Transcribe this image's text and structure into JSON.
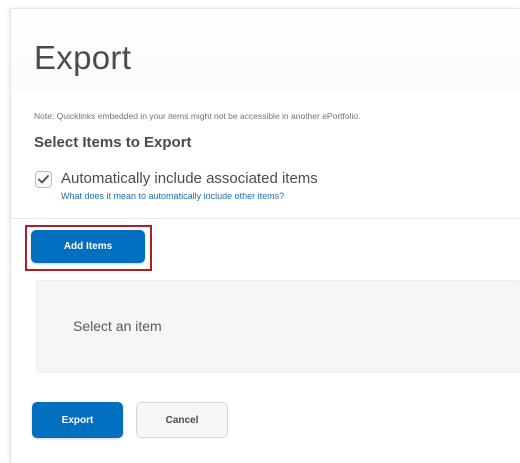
{
  "header": {
    "title": "Export"
  },
  "note": "Note: Quicklinks embedded in your items might not be accessible in another ePortfolio.",
  "section": {
    "title": "Select Items to Export"
  },
  "auto_include": {
    "checked": true,
    "label": "Automatically include associated items",
    "help_link": "What does it mean to automatically include other items?"
  },
  "add_items": {
    "label": "Add Items",
    "highlight_color": "#b11d24"
  },
  "selection": {
    "placeholder": "Select an item"
  },
  "actions": {
    "export_label": "Export",
    "cancel_label": "Cancel"
  },
  "colors": {
    "primary": "#006fbf",
    "link": "#1c6fb0",
    "text": "#494c4e"
  },
  "icons": {
    "checkbox": "checkmark-icon"
  }
}
